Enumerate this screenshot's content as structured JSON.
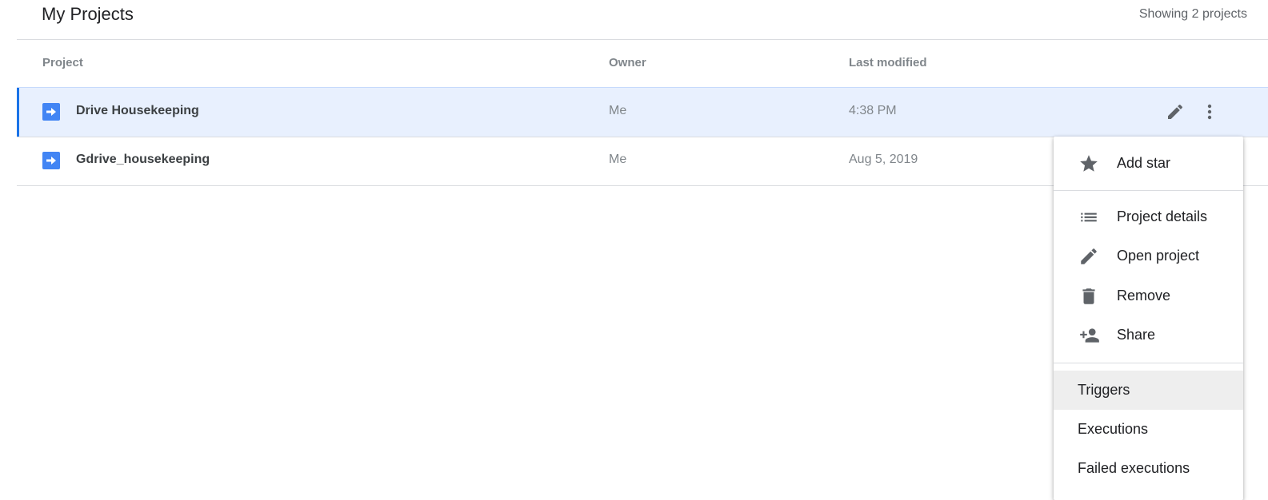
{
  "header": {
    "title": "My Projects",
    "count": "Showing 2 projects"
  },
  "columns": {
    "project": "Project",
    "owner": "Owner",
    "last_modified": "Last modified"
  },
  "rows": [
    {
      "name": "Drive Housekeeping",
      "owner": "Me",
      "modified": "4:38 PM",
      "selected": true,
      "icon": "apps-script-arrow-icon"
    },
    {
      "name": "Gdrive_housekeeping",
      "owner": "Me",
      "modified": "Aug 5, 2019",
      "selected": false,
      "icon": "apps-script-arrow-icon"
    }
  ],
  "row_actions": {
    "edit_icon": "pencil-icon",
    "more_icon": "more-vert-icon"
  },
  "menu": {
    "items": [
      {
        "label": "Add star",
        "icon": "star-icon"
      },
      {
        "label": "Project details",
        "icon": "list-icon"
      },
      {
        "label": "Open project",
        "icon": "pencil-icon"
      },
      {
        "label": "Remove",
        "icon": "trash-icon"
      },
      {
        "label": "Share",
        "icon": "person-add-icon"
      },
      {
        "label": "Triggers",
        "highlighted": true
      },
      {
        "label": "Executions"
      },
      {
        "label": "Failed executions"
      }
    ]
  },
  "colors": {
    "accent": "#1a73e8",
    "selected_row": "#e8f0fe",
    "project_icon": "#4285f4",
    "icon_gray": "#5f6368"
  }
}
